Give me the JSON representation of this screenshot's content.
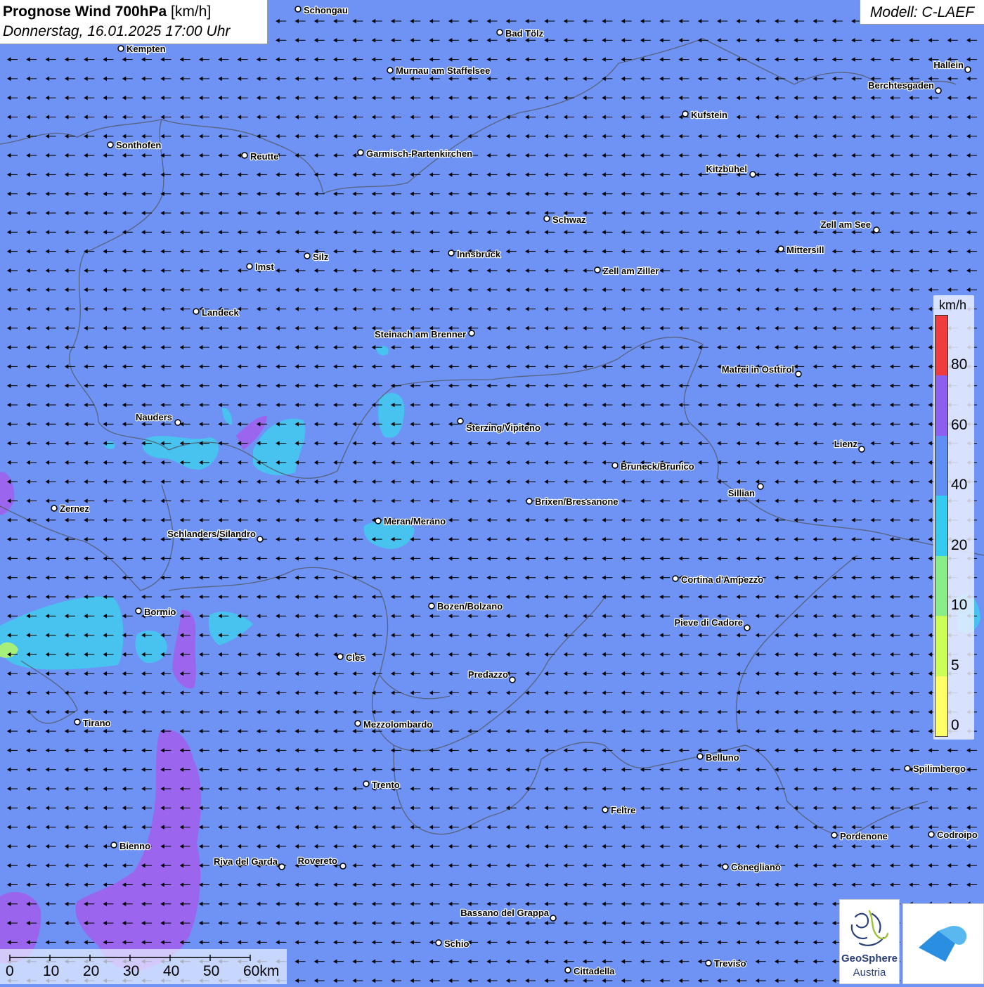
{
  "header": {
    "title_bold": "Prognose Wind 700hPa",
    "title_unit": "[km/h]",
    "datetime": "Donnerstag, 16.01.2025 17:00 Uhr",
    "model": "Modell: C-LAEF"
  },
  "legend": {
    "unit": "km/h",
    "colors": [
      "#ffff66",
      "#ccff55",
      "#88ee88",
      "#33ccf0",
      "#5f8ff5",
      "#8c5ff0",
      "#f03c3c"
    ],
    "labels": [
      "0",
      "5",
      "10",
      "20",
      "40",
      "60",
      "80"
    ]
  },
  "scale": {
    "labels": [
      "0",
      "10",
      "20",
      "30",
      "40",
      "50",
      "60km"
    ]
  },
  "wind": {
    "direction": "east-to-west",
    "background_speed_class": "40-60 km/h"
  },
  "places": [
    {
      "name": "Schongau"
    },
    {
      "name": "Bad Tölz"
    },
    {
      "name": "Kempten"
    },
    {
      "name": "Murnau am Staffelsee"
    },
    {
      "name": "Hallein"
    },
    {
      "name": "Berchtesgaden"
    },
    {
      "name": "Kufstein"
    },
    {
      "name": "Sonthofen"
    },
    {
      "name": "Reutte"
    },
    {
      "name": "Garmisch-Partenkirchen"
    },
    {
      "name": "Kitzbühel"
    },
    {
      "name": "Schwaz"
    },
    {
      "name": "Zell am See"
    },
    {
      "name": "Innsbruck"
    },
    {
      "name": "Mittersill"
    },
    {
      "name": "Silz"
    },
    {
      "name": "Imst"
    },
    {
      "name": "Zell am Ziller"
    },
    {
      "name": "Landeck"
    },
    {
      "name": "Steinach am Brenner"
    },
    {
      "name": "Matrei in Osttirol"
    },
    {
      "name": "Nauders"
    },
    {
      "name": "Sterzing/Vipiteno"
    },
    {
      "name": "Lienz"
    },
    {
      "name": "Bruneck/Brunico"
    },
    {
      "name": "Sillian"
    },
    {
      "name": "Zernez"
    },
    {
      "name": "Brixen/Bressanone"
    },
    {
      "name": "Meran/Merano"
    },
    {
      "name": "Schlanders/Silandro"
    },
    {
      "name": "Cortina d'Ampezzo"
    },
    {
      "name": "Bozen/Bolzano"
    },
    {
      "name": "Bormio"
    },
    {
      "name": "Pieve di Cadore"
    },
    {
      "name": "Cles"
    },
    {
      "name": "Predazzo"
    },
    {
      "name": "Tirano"
    },
    {
      "name": "Mezzolombardo"
    },
    {
      "name": "Belluno"
    },
    {
      "name": "Spilimbergo"
    },
    {
      "name": "Trento"
    },
    {
      "name": "Feltre"
    },
    {
      "name": "Pordenone"
    },
    {
      "name": "Codroipo"
    },
    {
      "name": "Bienno"
    },
    {
      "name": "Riva del Garda"
    },
    {
      "name": "Rovereto"
    },
    {
      "name": "Conegliano"
    },
    {
      "name": "Bassano del Grappa"
    },
    {
      "name": "Schio"
    },
    {
      "name": "Treviso"
    },
    {
      "name": "Cittadella"
    }
  ],
  "logos": {
    "geosphere_line1": "GeoSphere",
    "geosphere_line2": "Austria"
  }
}
